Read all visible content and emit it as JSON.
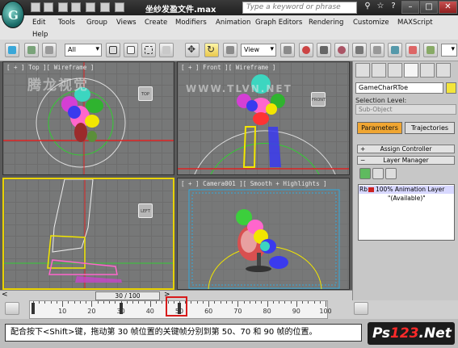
{
  "window": {
    "title": "坐纱发盈文件.max",
    "search_placeholder": "Type a keyword or phrase",
    "logo_letter": "G"
  },
  "menu": {
    "row1": [
      "Edit",
      "Tools",
      "Group",
      "Views",
      "Create",
      "Modifiers",
      "Animation",
      "Graph Editors",
      "Rendering",
      "Customize",
      "MAXScript"
    ],
    "row2": [
      "Help"
    ]
  },
  "toolbar": {
    "selection_filter": "All",
    "reference_coord": "View"
  },
  "viewports": {
    "top": "[ + ] Top ][ Wireframe ]",
    "front": "[ + ] Front ][ Wireframe ]",
    "left": "[ + ] Left ][ Wireframe ]",
    "camera": "[ + ] Camera001 ][ Smooth + Highlights ]",
    "watermark_top": "腾龙视觉",
    "watermark_url": "WWW.TLVN.NET",
    "viewcube_top": "TOP",
    "viewcube_front": "FRONT",
    "viewcube_left": "LEFT"
  },
  "command_panel": {
    "object_name": "GameCharRToe",
    "selection_level": "Selection Level:",
    "sub_object": "Sub-Object",
    "parameters": "Parameters",
    "trajectories": "Trajectories",
    "rollout_assign": "Assign Controller",
    "rollout_layer": "Layer Manager",
    "layer_row": "100% Animation Layer",
    "layer_available": "\"(Available)\"",
    "layer_prefix": "Rb"
  },
  "timeline": {
    "frame_display": "30 / 100",
    "nav_left": "<",
    "nav_right": ">",
    "ticks": [
      "0",
      "10",
      "20",
      "30",
      "40",
      "50",
      "60",
      "70",
      "80",
      "90",
      "100"
    ]
  },
  "caption": {
    "text": "配合按下<Shift>键，拖动第 30 帧位置的关键帧分别到第 50、70 和 90 帧的位置。"
  },
  "branding": {
    "ps_logo_white": "Ps",
    "ps_logo_red": "123",
    "ps_logo_suffix": ".Net"
  }
}
